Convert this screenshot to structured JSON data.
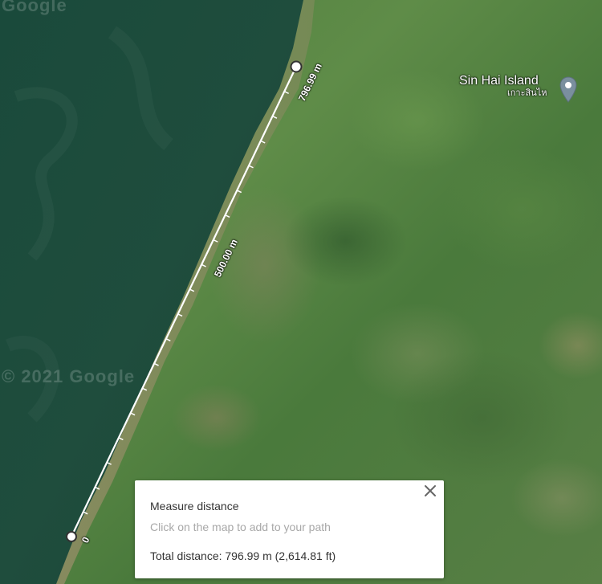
{
  "map": {
    "watermark_top": "Google",
    "watermark_mid": "© 2021 Google",
    "place": {
      "name": "Sin Hai Island",
      "native_name": "เกาะสินไห",
      "icon": "map-pin-icon"
    }
  },
  "measurement": {
    "start_label": "0",
    "mid_label": "500.00 m",
    "end_label": "796.99 m",
    "line_color": "#ffffff"
  },
  "panel": {
    "title": "Measure distance",
    "hint": "Click on the map to add to your path",
    "total": "Total distance: 796.99 m (2,614.81 ft)",
    "close_icon": "close-icon"
  },
  "colors": {
    "water": "#1f4a3c",
    "land": "#5a8a45",
    "panel_bg": "#ffffff",
    "hint_text": "#a8a8a8"
  }
}
